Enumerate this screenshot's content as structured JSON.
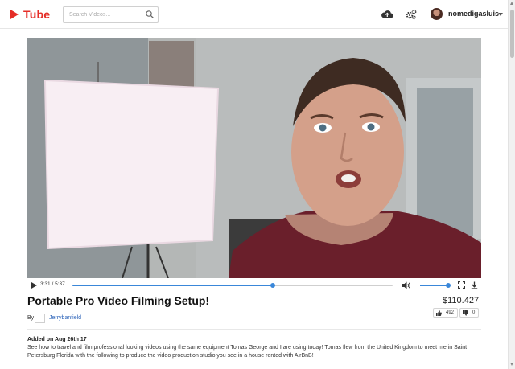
{
  "header": {
    "logo_text": "Tube",
    "search_placeholder": "Search Videos...",
    "username": "nomedigasluis"
  },
  "video": {
    "current_time": "3:31",
    "duration": "5:37",
    "progress_fraction": 0.626,
    "volume_fraction": 0.97
  },
  "details": {
    "title": "Portable Pro Video Filming Setup!",
    "price": "$110.427",
    "by_label": "By",
    "channel": "Jerrybanfield",
    "upvotes": "492",
    "downvotes": "0",
    "added": "Added on Aug 26th 17",
    "description": "See how to travel and film professional looking videos using the same equipment Tomas George and I are using today! Tomas flew from the United Kingdom to meet me in Saint Petersburg Florida with the following to produce the video production studio you see in a house rented with AirBnB!"
  },
  "colors": {
    "brand": "#e52d27",
    "accent": "#3a87d9",
    "link": "#2a62b8"
  }
}
